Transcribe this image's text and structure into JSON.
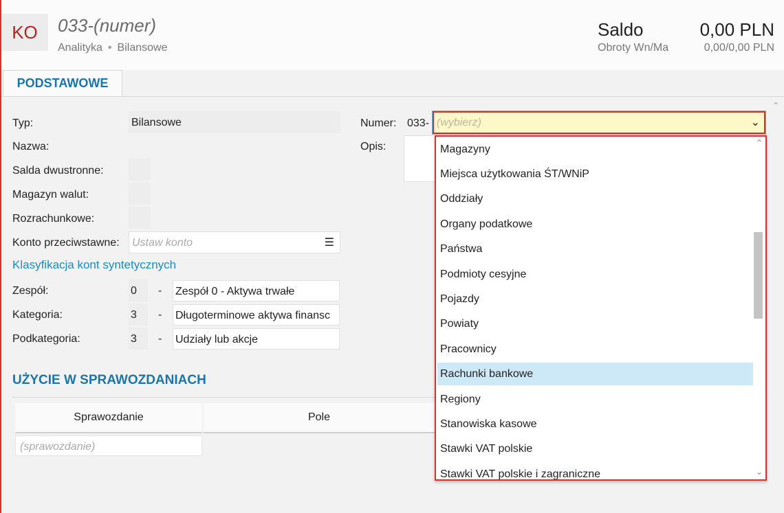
{
  "header": {
    "badge": "KO",
    "title": "033-(numer)",
    "subtitle_type": "Analityka",
    "subtitle_sep": "•",
    "subtitle_kind": "Bilansowe",
    "saldo_label": "Saldo",
    "saldo_value": "0,00 PLN",
    "obroty_label": "Obroty Wn/Ma",
    "obroty_value": "0,00/0,00 PLN"
  },
  "tabs": [
    {
      "label": "PODSTAWOWE"
    }
  ],
  "form": {
    "typ_label": "Typ:",
    "typ_value": "Bilansowe",
    "nazwa_label": "Nazwa:",
    "salda_label": "Salda dwustronne:",
    "magazyn_label": "Magazyn walut:",
    "rozrach_label": "Rozrachunkowe:",
    "konto_label": "Konto przeciwstawne:",
    "konto_placeholder": "Ustaw konto",
    "klasyfikacja_link": "Klasyfikacja kont syntetycznych",
    "zespol_label": "Zespół:",
    "zespol_code": "0",
    "zespol_name": "Zespół 0 - Aktywa trwałe",
    "kategoria_label": "Kategoria:",
    "kategoria_code": "3",
    "kategoria_name": "Długoterminowe aktywa finansc",
    "podkat_label": "Podkategoria:",
    "podkat_code": "3",
    "podkat_name": "Udziały lub akcje",
    "dash": "-",
    "numer_label": "Numer:",
    "numer_prefix": "033-",
    "numer_placeholder": "(wybierz)",
    "opis_label": "Opis:"
  },
  "usage": {
    "title": "UŻYCIE W SPRAWOZDANIACH",
    "columns": [
      "Sprawozdanie",
      "Pole"
    ],
    "row_placeholder": "(sprawozdanie)"
  },
  "dropdown": {
    "selected": "Rachunki bankowe",
    "options": [
      "Magazyny",
      "Miejsca użytkowania ŚT/WNiP",
      "Oddziały",
      "Organy podatkowe",
      "Państwa",
      "Podmioty cesyjne",
      "Pojazdy",
      "Powiaty",
      "Pracownicy",
      "Rachunki bankowe",
      "Regiony",
      "Stanowiska kasowe",
      "Stawki VAT polskie",
      "Stawki VAT polskie i zagraniczne"
    ]
  },
  "icons": {
    "menu": "☰",
    "chevron_down": "⌄",
    "chevron_up": "⌃",
    "collapse": "⌃"
  },
  "colors": {
    "accent_blue": "#1a75a8",
    "badge_red": "#b3261e",
    "highlight": "#cde8f6",
    "select_bg": "#fdf8c8",
    "error_border": "#d9302c"
  }
}
